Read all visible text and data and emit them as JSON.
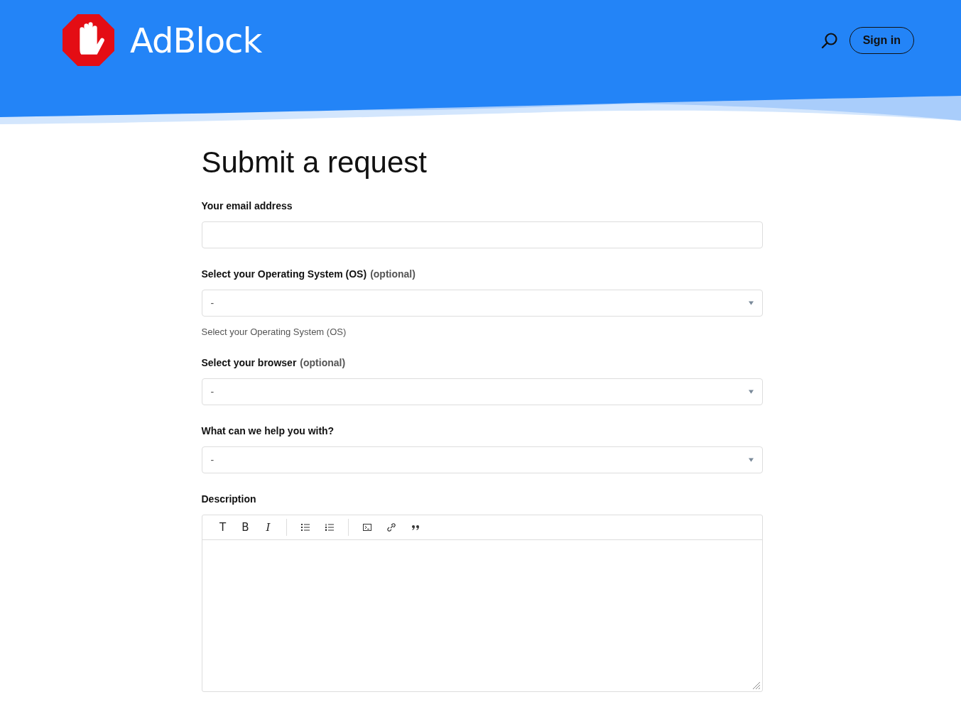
{
  "header": {
    "brand": "AdBlock",
    "sign_in": "Sign in"
  },
  "title": "Submit a request",
  "fields": [
    {
      "kind": "text",
      "label": "Your email address"
    },
    {
      "kind": "select",
      "label": "Select your Operating System (OS)",
      "optional": "(optional)",
      "value": "-",
      "hint": "Select your Operating System (OS)"
    },
    {
      "kind": "select",
      "label": "Select your browser",
      "optional": "(optional)",
      "value": "-"
    },
    {
      "kind": "select",
      "label": "What can we help you with?",
      "value": "-"
    },
    {
      "kind": "editor",
      "label": "Description"
    }
  ],
  "toolbar": [
    [
      {
        "kind": "text",
        "label": "T"
      },
      {
        "kind": "bold",
        "label": "B"
      },
      {
        "kind": "italic",
        "label": "I"
      }
    ],
    [
      {
        "kind": "bullets"
      },
      {
        "kind": "numbers"
      }
    ],
    [
      {
        "kind": "code"
      },
      {
        "kind": "link"
      },
      {
        "kind": "quote"
      }
    ]
  ]
}
